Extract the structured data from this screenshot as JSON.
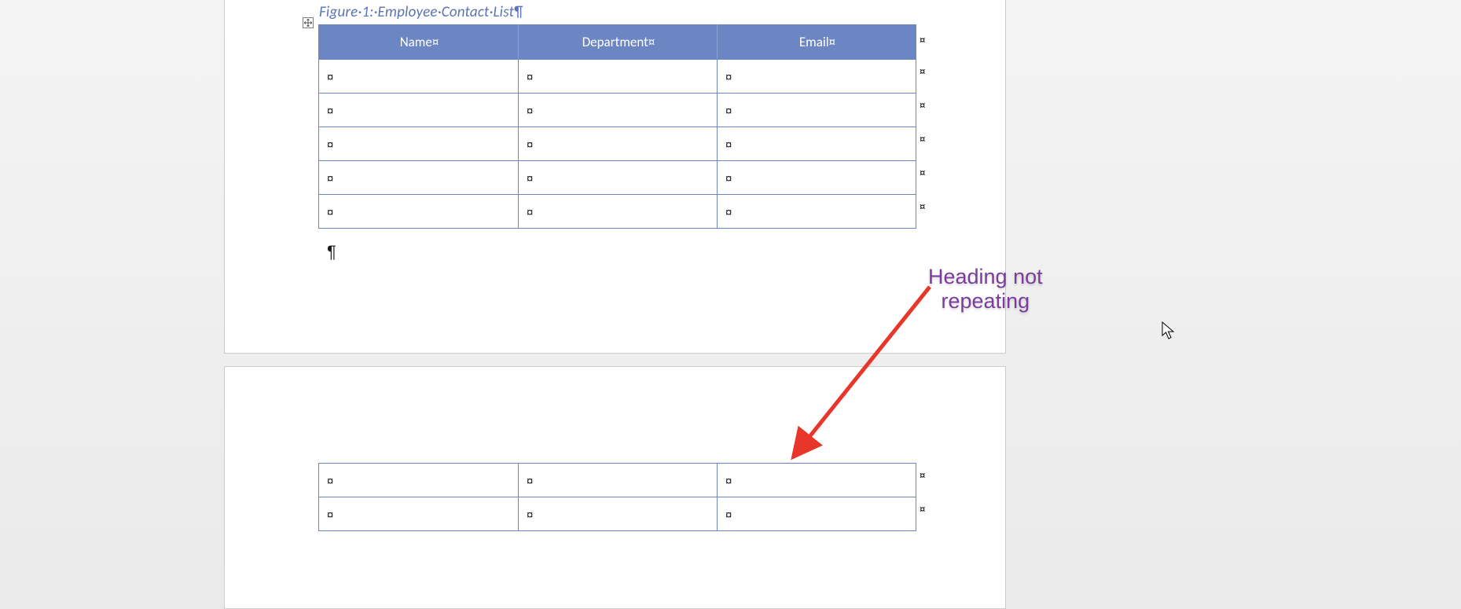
{
  "caption": {
    "prefix": "Figure·1:·",
    "title": "Employee·Contact·List",
    "pilcrow": "¶"
  },
  "table": {
    "headers": [
      "Name¤",
      "Department¤",
      "Email¤"
    ],
    "cell_mark": "¤",
    "row_end_mark": "¤",
    "page1_rows": 5,
    "page2_rows": 2
  },
  "paragraph_mark": "¶",
  "annotation": "Heading not\nrepeating",
  "icons": {
    "handle": "move-handle",
    "cursor": "mouse-pointer"
  }
}
